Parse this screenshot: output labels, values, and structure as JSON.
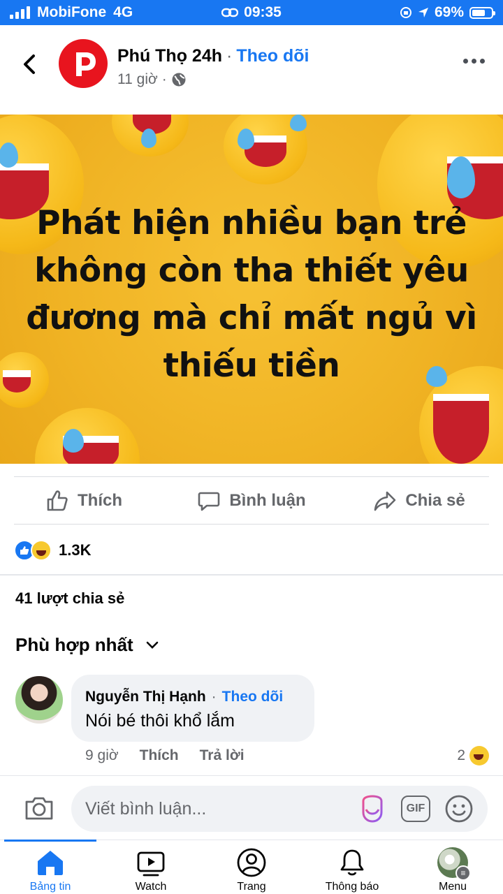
{
  "status_bar": {
    "carrier": "MobiFone",
    "network": "4G",
    "time": "09:35",
    "battery": "69%"
  },
  "post": {
    "page_name": "Phú Thọ 24h",
    "separator": "·",
    "follow_label": "Theo dõi",
    "time": "11 giờ",
    "meta_separator": "·",
    "privacy_icon": "globe-icon",
    "image_headline": "Phát hiện nhiều bạn trẻ không còn tha thiết yêu đương mà chỉ mất ngủ vì thiếu tiền"
  },
  "actions": {
    "like_label": "Thích",
    "comment_label": "Bình luận",
    "share_label": "Chia sẻ"
  },
  "reactions": {
    "count": "1.3K",
    "icons": [
      "like-reaction-icon",
      "haha-reaction-icon"
    ]
  },
  "shares_text": "41 lượt chia sẻ",
  "sort_label": "Phù hợp nhất",
  "comments": [
    {
      "author": "Nguyễn Thị Hạnh",
      "separator": "·",
      "follow_label": "Theo dõi",
      "text": "Nói bé thôi khổ lắm",
      "time": "9 giờ",
      "like_label": "Thích",
      "reply_label": "Trả lời",
      "reaction_count": "2"
    }
  ],
  "composer": {
    "placeholder": "Viết bình luận...",
    "gif_label": "GIF"
  },
  "bottom_nav": {
    "items": [
      {
        "label": "Bảng tin",
        "icon": "home-icon",
        "active": true
      },
      {
        "label": "Watch",
        "icon": "watch-icon"
      },
      {
        "label": "Trang",
        "icon": "profile-icon"
      },
      {
        "label": "Thông báo",
        "icon": "bell-icon"
      },
      {
        "label": "Menu",
        "icon": "menu-avatar-icon"
      }
    ]
  },
  "colors": {
    "brand": "#1877f2",
    "page_avatar": "#e8141e",
    "image_bg": "#f0b324"
  }
}
